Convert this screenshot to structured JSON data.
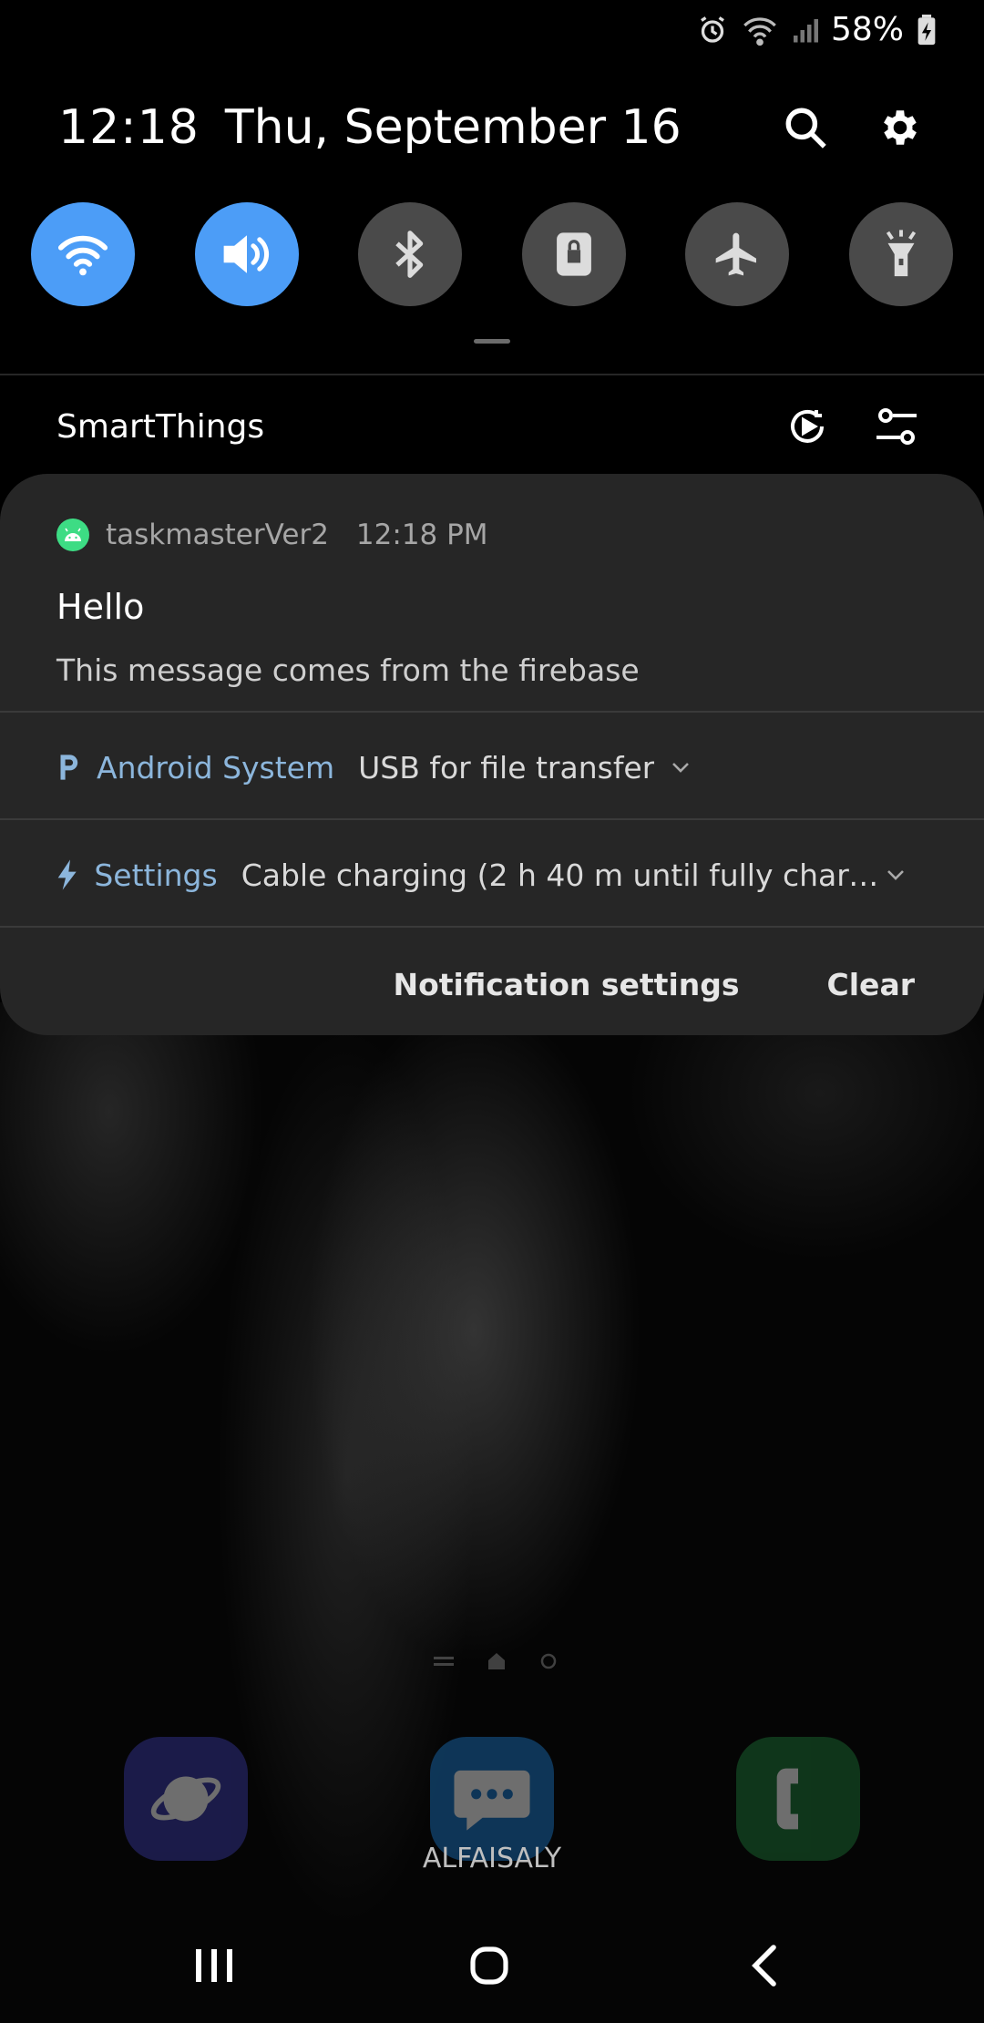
{
  "status_bar": {
    "battery": "58%"
  },
  "header": {
    "time": "12:18",
    "date": "Thu, September 16"
  },
  "quick_toggles": [
    {
      "name": "wifi",
      "active": true
    },
    {
      "name": "sound",
      "active": true
    },
    {
      "name": "bluetooth",
      "active": false
    },
    {
      "name": "screen-lock",
      "active": false
    },
    {
      "name": "airplane",
      "active": false
    },
    {
      "name": "flashlight",
      "active": false
    }
  ],
  "smartthings": {
    "label": "SmartThings"
  },
  "notification": {
    "app_name": "taskmasterVer2",
    "time": "12:18 PM",
    "title": "Hello",
    "text": "This message comes from the firebase"
  },
  "collapsed": [
    {
      "source": "Android System",
      "message": "USB for file transfer"
    },
    {
      "source": "Settings",
      "message": "Cable charging (2 h 40 m until fully charge..."
    }
  ],
  "panel_actions": {
    "settings_label": "Notification settings",
    "clear_label": "Clear"
  },
  "dock": {
    "label": "ALFAISALY"
  },
  "colors": {
    "accent": "#4c9df7",
    "panel": "#262626",
    "toggle_off": "#4a4a4a",
    "source_text": "#8cb6dc"
  }
}
